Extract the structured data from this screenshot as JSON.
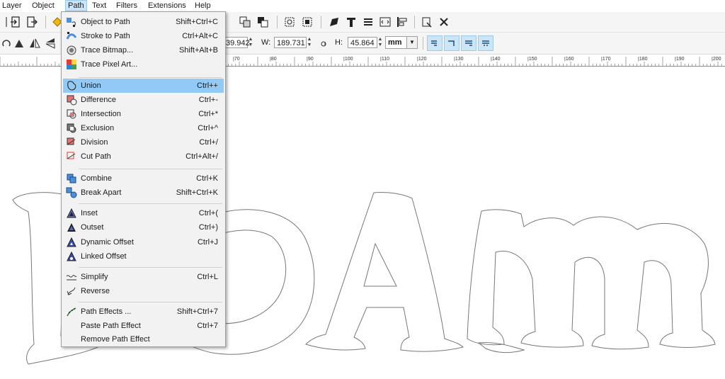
{
  "menubar": {
    "items": [
      "Layer",
      "Object",
      "Path",
      "Text",
      "Filters",
      "Extensions",
      "Help"
    ],
    "active": "Path"
  },
  "toolbar": {
    "x_value": "39.942",
    "w_label": "W:",
    "w_value": "189.731",
    "h_label": "H:",
    "h_value": "45.864",
    "unit": "mm"
  },
  "ruler": {
    "labels": [
      "|70",
      "|80",
      "|90",
      "|100",
      "|110",
      "|120",
      "|130",
      "|140",
      "|150",
      "|160",
      "|170",
      "|180",
      "|190",
      "|200"
    ]
  },
  "path_menu": {
    "items": [
      {
        "label": "Object to Path",
        "shortcut": "Shift+Ctrl+C",
        "icon": "object-to-path-icon"
      },
      {
        "label": "Stroke to Path",
        "shortcut": "Ctrl+Alt+C",
        "icon": "stroke-to-path-icon"
      },
      {
        "label": "Trace Bitmap...",
        "shortcut": "Shift+Alt+B",
        "icon": "trace-bitmap-icon"
      },
      {
        "label": "Trace Pixel Art...",
        "shortcut": "",
        "icon": "trace-pixel-art-icon"
      },
      {
        "label": "Union",
        "shortcut": "Ctrl++",
        "icon": "union-icon"
      },
      {
        "label": "Difference",
        "shortcut": "Ctrl+-",
        "icon": "difference-icon"
      },
      {
        "label": "Intersection",
        "shortcut": "Ctrl+*",
        "icon": "intersection-icon"
      },
      {
        "label": "Exclusion",
        "shortcut": "Ctrl+^",
        "icon": "exclusion-icon"
      },
      {
        "label": "Division",
        "shortcut": "Ctrl+/",
        "icon": "division-icon"
      },
      {
        "label": "Cut Path",
        "shortcut": "Ctrl+Alt+/",
        "icon": "cut-path-icon"
      },
      {
        "label": "Combine",
        "shortcut": "Ctrl+K",
        "icon": "combine-icon"
      },
      {
        "label": "Break Apart",
        "shortcut": "Shift+Ctrl+K",
        "icon": "break-apart-icon"
      },
      {
        "label": "Inset",
        "shortcut": "Ctrl+(",
        "icon": "inset-icon"
      },
      {
        "label": "Outset",
        "shortcut": "Ctrl+)",
        "icon": "outset-icon"
      },
      {
        "label": "Dynamic Offset",
        "shortcut": "Ctrl+J",
        "icon": "dynamic-offset-icon"
      },
      {
        "label": "Linked Offset",
        "shortcut": "",
        "icon": "linked-offset-icon"
      },
      {
        "label": "Simplify",
        "shortcut": "Ctrl+L",
        "icon": "simplify-icon"
      },
      {
        "label": "Reverse",
        "shortcut": "",
        "icon": "reverse-icon"
      },
      {
        "label": "Path Effects ...",
        "shortcut": "Shift+Ctrl+7",
        "icon": "path-effects-icon"
      },
      {
        "label": "Paste Path Effect",
        "shortcut": "Ctrl+7",
        "icon": ""
      },
      {
        "label": "Remove Path Effect",
        "shortcut": "",
        "icon": ""
      }
    ],
    "highlighted": "Union"
  },
  "colors": {
    "accent": "#91c9f7",
    "menu_bg": "#f2f2f2",
    "toggle_active": "#cde6f7"
  }
}
